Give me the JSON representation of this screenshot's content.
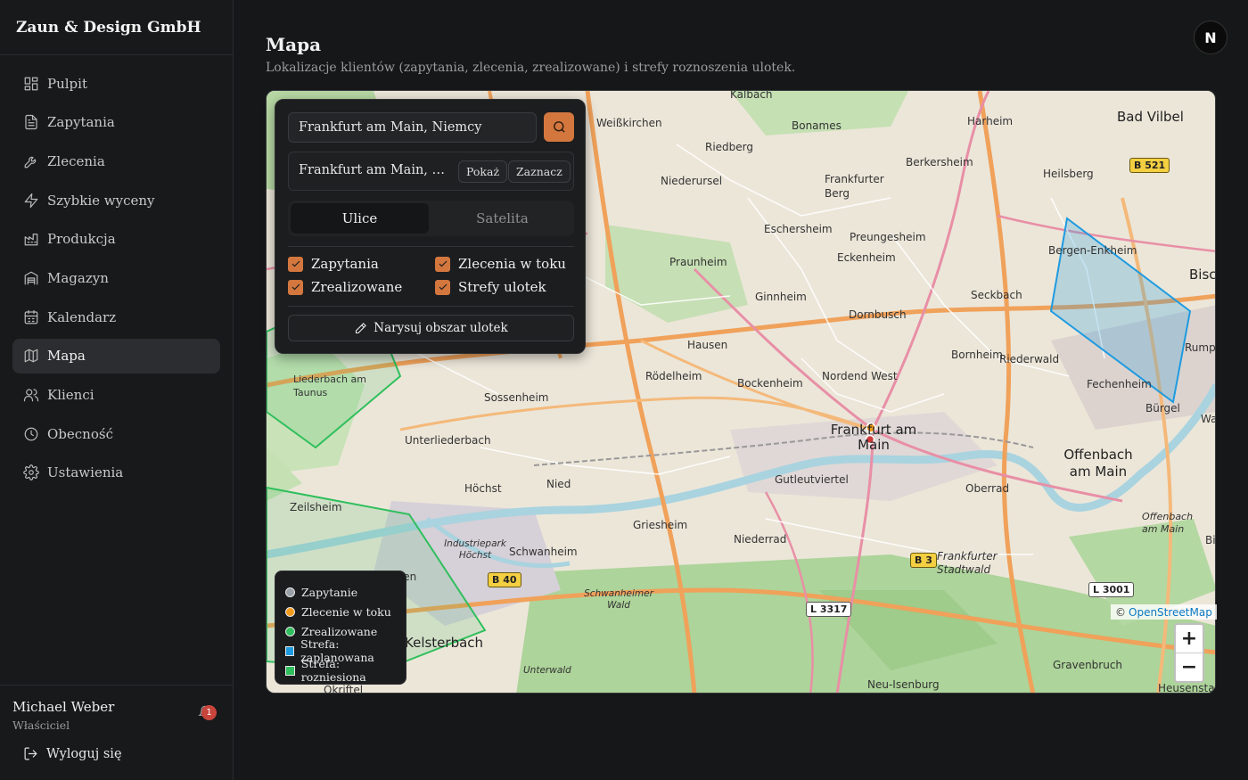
{
  "brand": "Zaun & Design GmbH",
  "nav": [
    {
      "label": "Pulpit",
      "icon": "dashboard-icon",
      "active": false
    },
    {
      "label": "Zapytania",
      "icon": "file-text-icon",
      "active": false
    },
    {
      "label": "Zlecenia",
      "icon": "wrench-icon",
      "active": false
    },
    {
      "label": "Szybkie wyceny",
      "icon": "lightning-icon",
      "active": false
    },
    {
      "label": "Produkcja",
      "icon": "factory-icon",
      "active": false
    },
    {
      "label": "Magazyn",
      "icon": "warehouse-icon",
      "active": false
    },
    {
      "label": "Kalendarz",
      "icon": "calendar-icon",
      "active": false
    },
    {
      "label": "Mapa",
      "icon": "map-icon",
      "active": true
    },
    {
      "label": "Klienci",
      "icon": "users-icon",
      "active": false
    },
    {
      "label": "Obecność",
      "icon": "clock-icon",
      "active": false
    },
    {
      "label": "Ustawienia",
      "icon": "gear-icon",
      "active": false
    }
  ],
  "user": {
    "name": "Michael Weber",
    "role": "Właściciel",
    "notifications": "1",
    "logout_label": "Wyloguj się"
  },
  "header": {
    "title": "Mapa",
    "subtitle": "Lokalizacje klientów (zapytania, zlecenia, zrealizowane) i strefy roznoszenia ulotek.",
    "avatar_letter": "N"
  },
  "panel": {
    "search_value": "Frankfurt am Main, Niemcy",
    "result_text": "Frankfurt am Main, Hessen, Deutschland",
    "show_label": "Pokaż",
    "mark_label": "Zaznacz",
    "view_modes": [
      "Ulice",
      "Satelita"
    ],
    "active_view": "Ulice",
    "filters": [
      {
        "label": "Zapytania",
        "checked": true
      },
      {
        "label": "Zlecenia w toku",
        "checked": true
      },
      {
        "label": "Zrealizowane",
        "checked": true
      },
      {
        "label": "Strefy ulotek",
        "checked": true
      }
    ],
    "draw_label": "Narysuj obszar ulotek"
  },
  "legend": [
    {
      "label": "Zapytanie",
      "shape": "dot",
      "color": "#9aa0a8"
    },
    {
      "label": "Zlecenie w toku",
      "shape": "dot",
      "color": "#f29c1f"
    },
    {
      "label": "Zrealizowane",
      "shape": "dot",
      "color": "#2fbf5c"
    },
    {
      "label": "Strefa: zaplanowana",
      "shape": "square",
      "color": "#1e9be0"
    },
    {
      "label": "Strefa: rozniesiona",
      "shape": "square",
      "color": "#2fbf5c"
    }
  ],
  "map": {
    "attribution_prefix": "©",
    "attribution_link": "OpenStreetMap",
    "zoom_in": "+",
    "zoom_out": "−",
    "places": [
      "Kalbach",
      "Bad Vilbel",
      "Weißkirchen",
      "Bonames",
      "Harheim",
      "Riedberg",
      "Berkersheim",
      "Heilsberg",
      "Niederursel",
      "Frankfurter Berg",
      "Eschersheim",
      "Preungesheim",
      "Bergen-Enkheim",
      "Praunheim",
      "Eckenheim",
      "Seckbach",
      "Bischof",
      "Ginnheim",
      "Dornbusch",
      "Hausen",
      "Bornheim",
      "Riederwald",
      "Rumpenh",
      "Rödelheim",
      "Bockenheim",
      "Nordend West",
      "Fechenheim",
      "Liederbach am Taunus",
      "Sossenheim",
      "Bürgel",
      "Wal",
      "Frankfurt am Main",
      "Offenbach am Main",
      "Unterliederbach",
      "Nied",
      "Gutleutviertel",
      "Oberrad",
      "Höchst",
      "Zeilsheim",
      "Griesheim",
      "Industriepark Höchst",
      "Niederrad",
      "Schwanheim",
      "Frankfurter Stadtwald",
      "Offenbach am Main",
      "Bi",
      "Schwanheimer Wald",
      "Kelsterbach",
      "Unterwald",
      "Gravenbruch",
      "Neu-Isenburg",
      "Heusenstа",
      "Okriftel",
      "ngen"
    ],
    "road_badges": [
      "B 521",
      "B 40",
      "B 3",
      "L 3317",
      "L 3001"
    ]
  }
}
